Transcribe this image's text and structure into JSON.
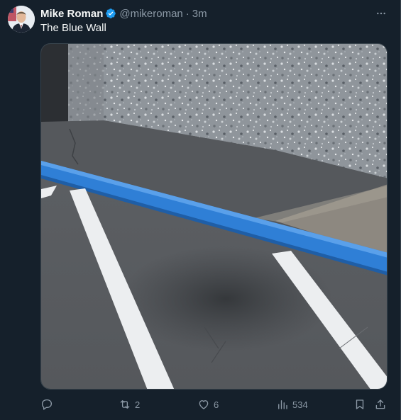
{
  "tweet": {
    "author_name": "Mike Roman",
    "author_handle": "@mikeroman",
    "separator": "·",
    "timestamp": "3m",
    "text": "The Blue Wall",
    "media_alt": "Parking lot curb painted blue in front of a gray speckled wall"
  },
  "icons": {
    "avatar": "avatar",
    "verified": "verified-badge-icon",
    "more": "more-icon",
    "reply": "reply-icon",
    "retweet": "retweet-icon",
    "like": "heart-icon",
    "views": "views-icon",
    "bookmark": "bookmark-icon",
    "share": "share-icon"
  },
  "stats": {
    "reposts": "2",
    "likes": "6",
    "views": "534"
  },
  "colors": {
    "background": "#15202b",
    "text": "#f7f9f9",
    "muted": "#8b98a5",
    "verified": "#1d9bf0",
    "curb_blue": "#2f7fd6"
  }
}
